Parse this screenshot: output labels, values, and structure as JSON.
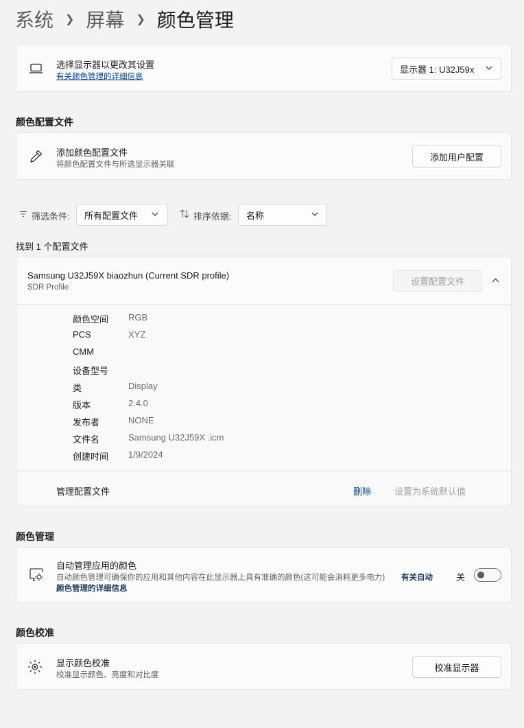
{
  "breadcrumb": {
    "level1": "系统",
    "level2": "屏幕",
    "current": "颜色管理"
  },
  "display_select": {
    "title": "选择显示器以更改其设置",
    "link": "有关颜色管理的详细信息",
    "dropdown_value": "显示器 1: U32J59x"
  },
  "profiles_section": {
    "title": "颜色配置文件",
    "add_title": "添加颜色配置文件",
    "add_desc": "将颜色配置文件与所选显示器关联",
    "add_button": "添加用户配置"
  },
  "filter": {
    "filter_label": "筛选条件:",
    "filter_value": "所有配置文件",
    "sort_label": "排序依据:",
    "sort_value": "名称"
  },
  "found_text": "找到 1 个配置文件",
  "profile": {
    "name": "Samsung U32J59X biaozhun (Current SDR profile)",
    "type": "SDR Profile",
    "set_button": "设置配置文件",
    "properties": [
      {
        "label": "颜色空间",
        "value": "RGB"
      },
      {
        "label": "PCS",
        "value": "XYZ"
      },
      {
        "label": "CMM",
        "value": ""
      },
      {
        "label": "设备型号",
        "value": ""
      },
      {
        "label": "类",
        "value": "Display"
      },
      {
        "label": "版本",
        "value": "2.4.0"
      },
      {
        "label": "发布者",
        "value": "NONE"
      },
      {
        "label": "文件名",
        "value": "Samsung U32J59X .icm"
      },
      {
        "label": "创建时间",
        "value": "1/9/2024"
      }
    ],
    "manage_label": "管理配置文件",
    "delete_button": "删除",
    "set_default_button": "设置为系统默认值"
  },
  "color_management": {
    "title": "颜色管理",
    "auto_title": "自动管理应用的颜色",
    "auto_desc": "自动颜色管理可确保你的应用和其他内容在此显示器上具有准确的颜色(这可能会消耗更多电力)",
    "auto_link_line1": "有关自动",
    "auto_link_line2": "颜色管理的详细信息",
    "toggle_state_label": "关",
    "toggle_on": false
  },
  "calibration": {
    "title": "颜色校准",
    "cal_title": "显示颜色校准",
    "cal_desc": "校准显示颜色、亮度和对比度",
    "cal_button": "校准显示器"
  },
  "colors": {
    "accent_link": "#003e92",
    "background": "#f3f3f3",
    "card": "#fbfbfb"
  },
  "icons": [
    "laptop-icon",
    "eyedropper-icon",
    "filter-icon",
    "sort-icon",
    "chevron-down-icon",
    "chevron-up-icon",
    "display-color-icon",
    "brightness-icon"
  ]
}
